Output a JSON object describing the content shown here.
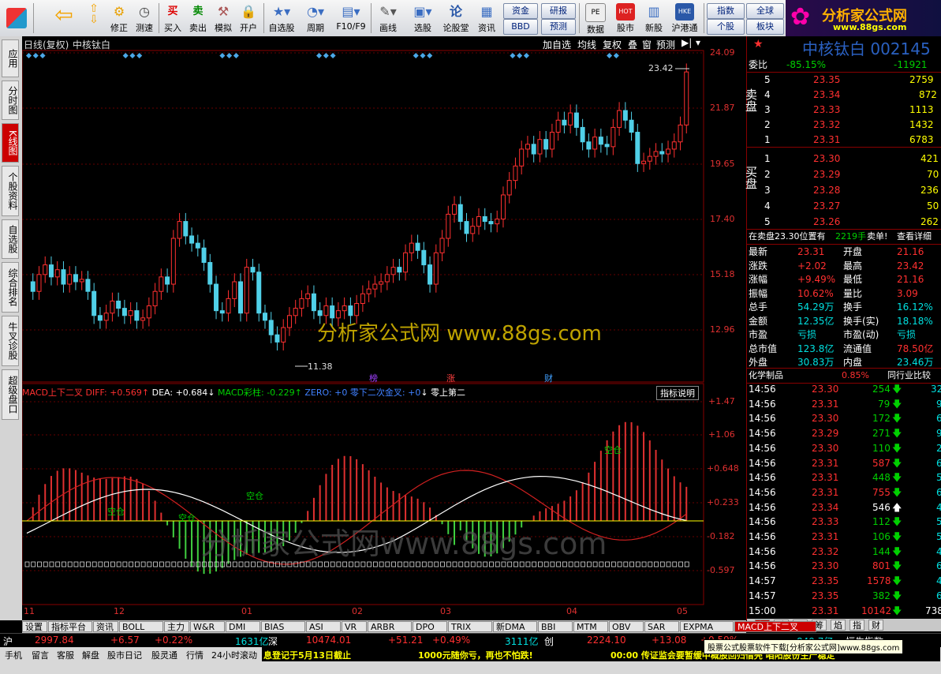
{
  "toolbar": {
    "buttons": [
      {
        "label": "",
        "icon": "grid-icon"
      },
      {
        "label": "",
        "icon": "back-icon"
      },
      {
        "label": "",
        "icon": "up-down-icon"
      },
      {
        "label": "修正",
        "icon": "gear-icon"
      },
      {
        "label": "测速",
        "icon": "clock-icon"
      },
      {
        "label": "买入",
        "icon": "buy-icon",
        "glyph": "买"
      },
      {
        "label": "卖出",
        "icon": "sell-icon",
        "glyph": "卖"
      },
      {
        "label": "模拟",
        "icon": "hammer-icon"
      },
      {
        "label": "开户",
        "icon": "lock-icon"
      },
      {
        "label": "自选股",
        "icon": "star-icon"
      },
      {
        "label": "周期",
        "icon": "cycle-icon"
      },
      {
        "label": "F10/F9",
        "icon": "f10-icon"
      },
      {
        "label": "画线",
        "icon": "pen-icon"
      },
      {
        "label": "选股",
        "icon": "select-icon"
      },
      {
        "label": "论股堂",
        "icon": "forum-icon"
      },
      {
        "label": "资讯",
        "icon": "news-icon"
      },
      {
        "label": "数据",
        "icon": "data-icon",
        "glyph": "PE"
      },
      {
        "label": "股市",
        "icon": "market-icon",
        "glyph": "HOT"
      },
      {
        "label": "新股",
        "icon": "newstock-icon"
      },
      {
        "label": "沪港通",
        "icon": "hk-icon",
        "glyph": "HKE"
      }
    ],
    "right_buttons": [
      "资金",
      "研报",
      "BBD",
      "预测",
      "指数",
      "全球",
      "个股",
      "板块"
    ],
    "brand": "分析家公式网",
    "brand_url": "www.88gs.com"
  },
  "left_tabs": [
    "应用",
    "分时图",
    "K线图",
    "个股资料",
    "自选股",
    "综合排名",
    "牛叉诊股",
    "超级盘口"
  ],
  "chart": {
    "header_left": "日线(复权)",
    "stock_name": "中核钛白",
    "header_buttons": [
      "加自选",
      "均线",
      "复权",
      "叠",
      "窗",
      "预测"
    ],
    "price_axis": [
      "24.09",
      "21.87",
      "19.65",
      "17.40",
      "15.18",
      "12.96"
    ],
    "macd_axis": [
      "+1.47",
      "+1.06",
      "+0.648",
      "+0.233",
      "-0.182",
      "-0.597"
    ],
    "high_label": "23.42",
    "low_label": "11.38",
    "event_tags": [
      "榜",
      "涨",
      "财"
    ],
    "watermark1": "分析家公式网 www.88gs.com",
    "watermark2": "分析家公式网www.88gs.com",
    "indicator_line": {
      "name": "MACD上下二叉",
      "diff": "DIFF: +0.569",
      "dea": "DEA: +0.684",
      "macd": "MACD彩柱: -0.229",
      "zero": "ZERO: +0",
      "cross": "零下二次金叉: +0",
      "zero_up": "零上第二"
    },
    "indicator_btn": "指标说明",
    "signal_labels": [
      "空仓",
      "空仓",
      "空仓",
      "空仓"
    ],
    "x_axis": [
      "11",
      "12",
      "01",
      "02",
      "03",
      "04",
      "05"
    ]
  },
  "chart_data": {
    "type": "candlestick",
    "title": "中核钛白",
    "ylim": [
      11.0,
      24.09
    ],
    "high": 23.42,
    "low": 11.38,
    "last": 23.31
  },
  "quote": {
    "title": "中核钛白 002145",
    "weibi_label": "委比",
    "weibi": "-85.15%",
    "weicha": "-11921",
    "sell_label": "卖盘",
    "buy_label": "买盘",
    "asks": [
      {
        "lvl": "5",
        "price": "23.35",
        "vol": "2759"
      },
      {
        "lvl": "4",
        "price": "23.34",
        "vol": "872"
      },
      {
        "lvl": "3",
        "price": "23.33",
        "vol": "1113"
      },
      {
        "lvl": "2",
        "price": "23.32",
        "vol": "1432"
      },
      {
        "lvl": "1",
        "price": "23.31",
        "vol": "6783"
      }
    ],
    "bids": [
      {
        "lvl": "1",
        "price": "23.30",
        "vol": "421"
      },
      {
        "lvl": "2",
        "price": "23.29",
        "vol": "70"
      },
      {
        "lvl": "3",
        "price": "23.28",
        "vol": "236"
      },
      {
        "lvl": "4",
        "price": "23.27",
        "vol": "50"
      },
      {
        "lvl": "5",
        "price": "23.26",
        "vol": "262"
      }
    ],
    "notice_a": "在卖盘23.30位置有",
    "notice_b": "2219手",
    "notice_c": "卖单!",
    "notice_link": "查看详细",
    "stats": [
      {
        "l1": "最新",
        "v1": "23.31",
        "l2": "开盘",
        "v2": "21.16"
      },
      {
        "l1": "涨跌",
        "v1": "+2.02",
        "l2": "最高",
        "v2": "23.42"
      },
      {
        "l1": "涨幅",
        "v1": "+9.49%",
        "l2": "最低",
        "v2": "21.16"
      },
      {
        "l1": "振幅",
        "v1": "10.62%",
        "l2": "量比",
        "v2": "3.09"
      },
      {
        "l1": "总手",
        "v1": "54.29万",
        "l2": "换手",
        "v2": "16.12%"
      },
      {
        "l1": "金额",
        "v1": "12.35亿",
        "l2": "换手(实)",
        "v2": "18.18%"
      },
      {
        "l1": "市盈",
        "v1": "亏损",
        "l2": "市盈(动)",
        "v2": "亏损"
      },
      {
        "l1": "总市值",
        "v1": "123.8亿",
        "l2": "流通值",
        "v2": "78.50亿"
      },
      {
        "l1": "外盘",
        "v1": "30.83万",
        "l2": "内盘",
        "v2": "23.46万"
      }
    ],
    "sector": "化学制品",
    "sector_pct": "0.85%",
    "sector_link": "同行业比较",
    "ticks": [
      {
        "t": "14:56",
        "p": "23.30",
        "v": "254",
        "d": "down",
        "n": "32"
      },
      {
        "t": "14:56",
        "p": "23.31",
        "v": "79",
        "d": "down",
        "n": "9"
      },
      {
        "t": "14:56",
        "p": "23.30",
        "v": "172",
        "d": "down",
        "n": "6"
      },
      {
        "t": "14:56",
        "p": "23.29",
        "v": "271",
        "d": "down",
        "n": "9"
      },
      {
        "t": "14:56",
        "p": "23.30",
        "v": "110",
        "d": "down",
        "n": "2"
      },
      {
        "t": "14:56",
        "p": "23.31",
        "v": "587",
        "d": "down",
        "n": "6"
      },
      {
        "t": "14:56",
        "p": "23.31",
        "v": "448",
        "d": "down",
        "n": "5"
      },
      {
        "t": "14:56",
        "p": "23.31",
        "v": "755",
        "d": "down",
        "n": "6"
      },
      {
        "t": "14:56",
        "p": "23.34",
        "v": "546",
        "d": "up",
        "n": "4"
      },
      {
        "t": "14:56",
        "p": "23.33",
        "v": "112",
        "d": "down",
        "n": "5"
      },
      {
        "t": "14:56",
        "p": "23.31",
        "v": "106",
        "d": "down",
        "n": "5"
      },
      {
        "t": "14:56",
        "p": "23.32",
        "v": "144",
        "d": "down",
        "n": "4"
      },
      {
        "t": "14:56",
        "p": "23.30",
        "v": "801",
        "d": "down",
        "n": "6"
      },
      {
        "t": "14:57",
        "p": "23.35",
        "v": "1578",
        "d": "down",
        "n": "4"
      },
      {
        "t": "14:57",
        "p": "23.35",
        "v": "382",
        "d": "down",
        "n": "6"
      },
      {
        "t": "15:00",
        "p": "23.31",
        "v": "10142",
        "d": "down",
        "n": "738"
      }
    ],
    "bottom_tabs": [
      "细",
      "诊",
      "分",
      "筹",
      "焰",
      "指",
      "财"
    ]
  },
  "bottom_tabs": [
    "设置",
    "指标平台",
    "资讯",
    "BOLL",
    "主力",
    "W&R",
    "DMI",
    "BIAS",
    "ASI",
    "VR",
    "ARBR",
    "DPO",
    "TRIX",
    "新DMA",
    "BBI",
    "MTM",
    "OBV",
    "SAR",
    "EXPMA",
    "MACD上下二叉"
  ],
  "status": {
    "sh_label": "沪",
    "sh_idx": "2997.84",
    "sh_chg": "+6.57",
    "sh_pct": "+0.22%",
    "sh_amt": "1631亿",
    "sz_label": "深",
    "sz_idx": "10474.01",
    "sz_chg": "+51.21",
    "sz_pct": "+0.49%",
    "sz_amt": "3111亿",
    "cy_label": "创",
    "cy_idx": "2224.10",
    "cy_chg": "+13.08",
    "cy_extra": "+0.59%",
    "cy_amt": "849.7亿",
    "tail": "恒生指数",
    "links": [
      "手机",
      "留言",
      "客服",
      "解盘",
      "股市日记",
      "股灵通",
      "行情",
      "24小时滚动"
    ],
    "ticker1": "息登记于5月13日截止",
    "ticker2": "1000元随你亏，再也不怕跌!",
    "ticker3": "00:00 传证监会要暂缓中概股回归借壳  咱阳股份生产稳定",
    "tooltip": "股票公式股票软件下载[分析家公式网]www.88gs.com"
  }
}
